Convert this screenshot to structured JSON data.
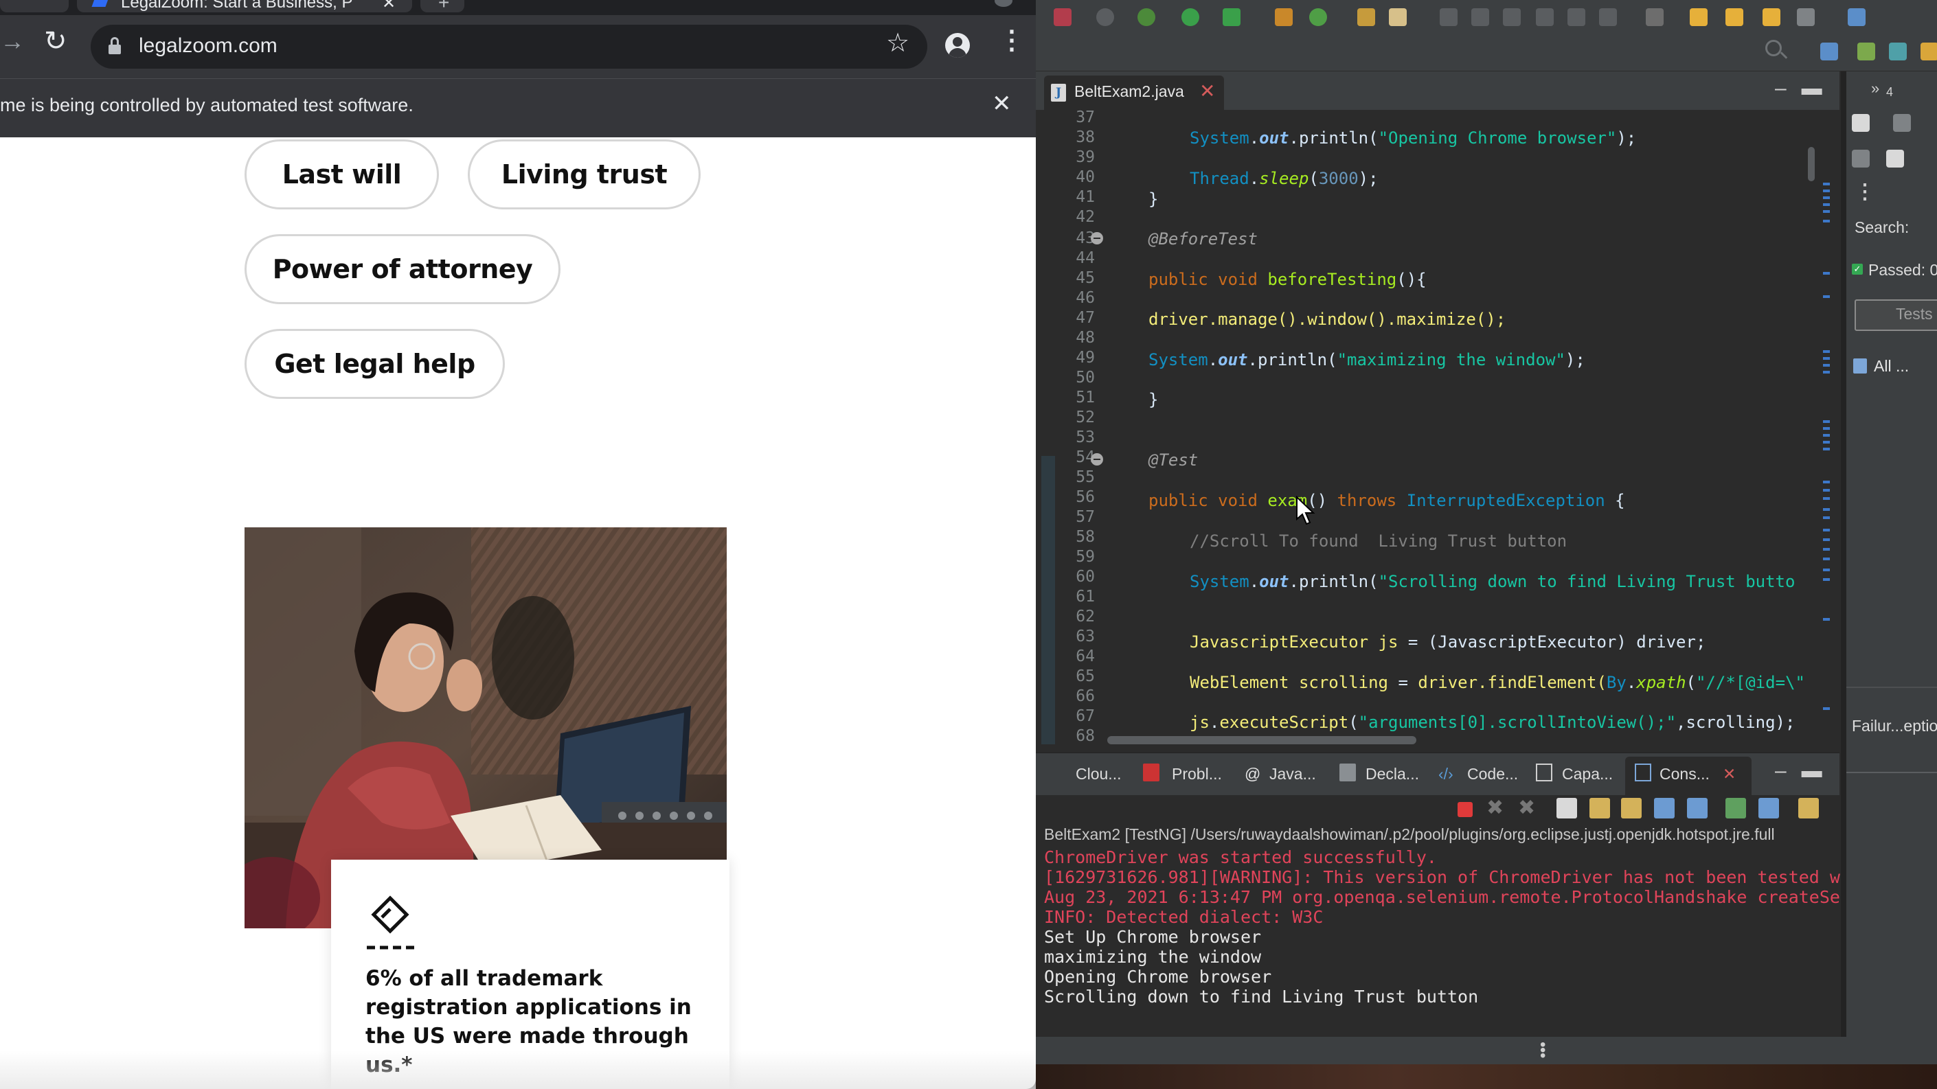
{
  "browser": {
    "tab_title": "LegalZoom: Start a Business, P",
    "url": "legalzoom.com",
    "infobar_message": "me is being controlled by automated test software."
  },
  "page": {
    "pills": [
      "Last will",
      "Living trust",
      "Power of attorney",
      "Get legal help"
    ],
    "stat_text": "6% of all trademark registration applications in the US were made through us.*"
  },
  "ide": {
    "editor_tab": "BeltExam2.java",
    "line_numbers": [
      "37",
      "38",
      "39",
      "40",
      "41",
      "42",
      "43",
      "44",
      "45",
      "46",
      "47",
      "48",
      "49",
      "50",
      "51",
      "52",
      "53",
      "54",
      "55",
      "56",
      "57",
      "58",
      "59",
      "60",
      "61",
      "62",
      "63",
      "64",
      "65",
      "66",
      "67",
      "68"
    ],
    "code": {
      "l38": {
        "obj": "System",
        "fld": "out",
        "m": "println",
        "str": "\"Opening Chrome browser\""
      },
      "l40": {
        "obj": "Thread",
        "m": "sleep",
        "num": "3000"
      },
      "l43": "@BeforeTest",
      "l45": {
        "kw": "public void",
        "name": "beforeTesting"
      },
      "l47": "driver.manage().window().maximize();",
      "l49": {
        "obj": "System",
        "fld": "out",
        "m": "println",
        "str": "\"maximizing the window\""
      },
      "l54": "@Test",
      "l56": {
        "kw": "public void",
        "name": "exam",
        "throws": "throws",
        "exc": "InterruptedException"
      },
      "l58": "//Scroll To found  Living Trust button",
      "l60": {
        "obj": "System",
        "fld": "out",
        "m": "println",
        "str": "\"Scrolling down to find Living Trust butto"
      },
      "l63": {
        "type": "JavascriptExecutor",
        "var": "js",
        "cast": "(JavascriptExecutor)",
        "rest": "driver;"
      },
      "l65": {
        "type": "WebElement",
        "var": "scrolling",
        "call": "driver.findElement(",
        "by": "By",
        "m": "xpath",
        "str": "\"//*[@id=\\\""
      },
      "l67": {
        "var": "js",
        "m": "executeScript",
        "str": "\"arguments[0].scrollIntoView();\"",
        "rest": ",scrolling);"
      }
    },
    "console_tabs": [
      "Clou...",
      "Probl...",
      "Java...",
      "Decla...",
      "Code...",
      "Capa...",
      "Cons..."
    ],
    "console_header": "BeltExam2 [TestNG] /Users/ruwaydaalshowiman/.p2/pool/plugins/org.eclipse.justj.openjdk.hotspot.jre.full",
    "console_lines": [
      {
        "type": "err",
        "text": "ChromeDriver was started successfully."
      },
      {
        "type": "err",
        "text": "[1629731626.981][WARNING]: This version of ChromeDriver has not been tested w"
      },
      {
        "type": "err",
        "text": "Aug 23, 2021 6:13:47 PM org.openqa.selenium.remote.ProtocolHandshake createSe"
      },
      {
        "type": "err",
        "text": "INFO: Detected dialect: W3C"
      },
      {
        "type": "out",
        "text": "Set Up Chrome browser"
      },
      {
        "type": "out",
        "text": "maximizing the window"
      },
      {
        "type": "out",
        "text": "Opening Chrome browser"
      },
      {
        "type": "out",
        "text": "Scrolling down to find Living Trust button"
      }
    ],
    "side_panel": {
      "tab_count": "4",
      "search_label": "Search:",
      "passed_label": "Passed: 0",
      "button_label": "Tests",
      "all_label": "All ...",
      "failure_label": "Failur...eptio"
    },
    "colors": {
      "console_error": "#e0445a",
      "console_out": "#e6e6e6",
      "editor_bg": "#2b2b2b"
    }
  }
}
